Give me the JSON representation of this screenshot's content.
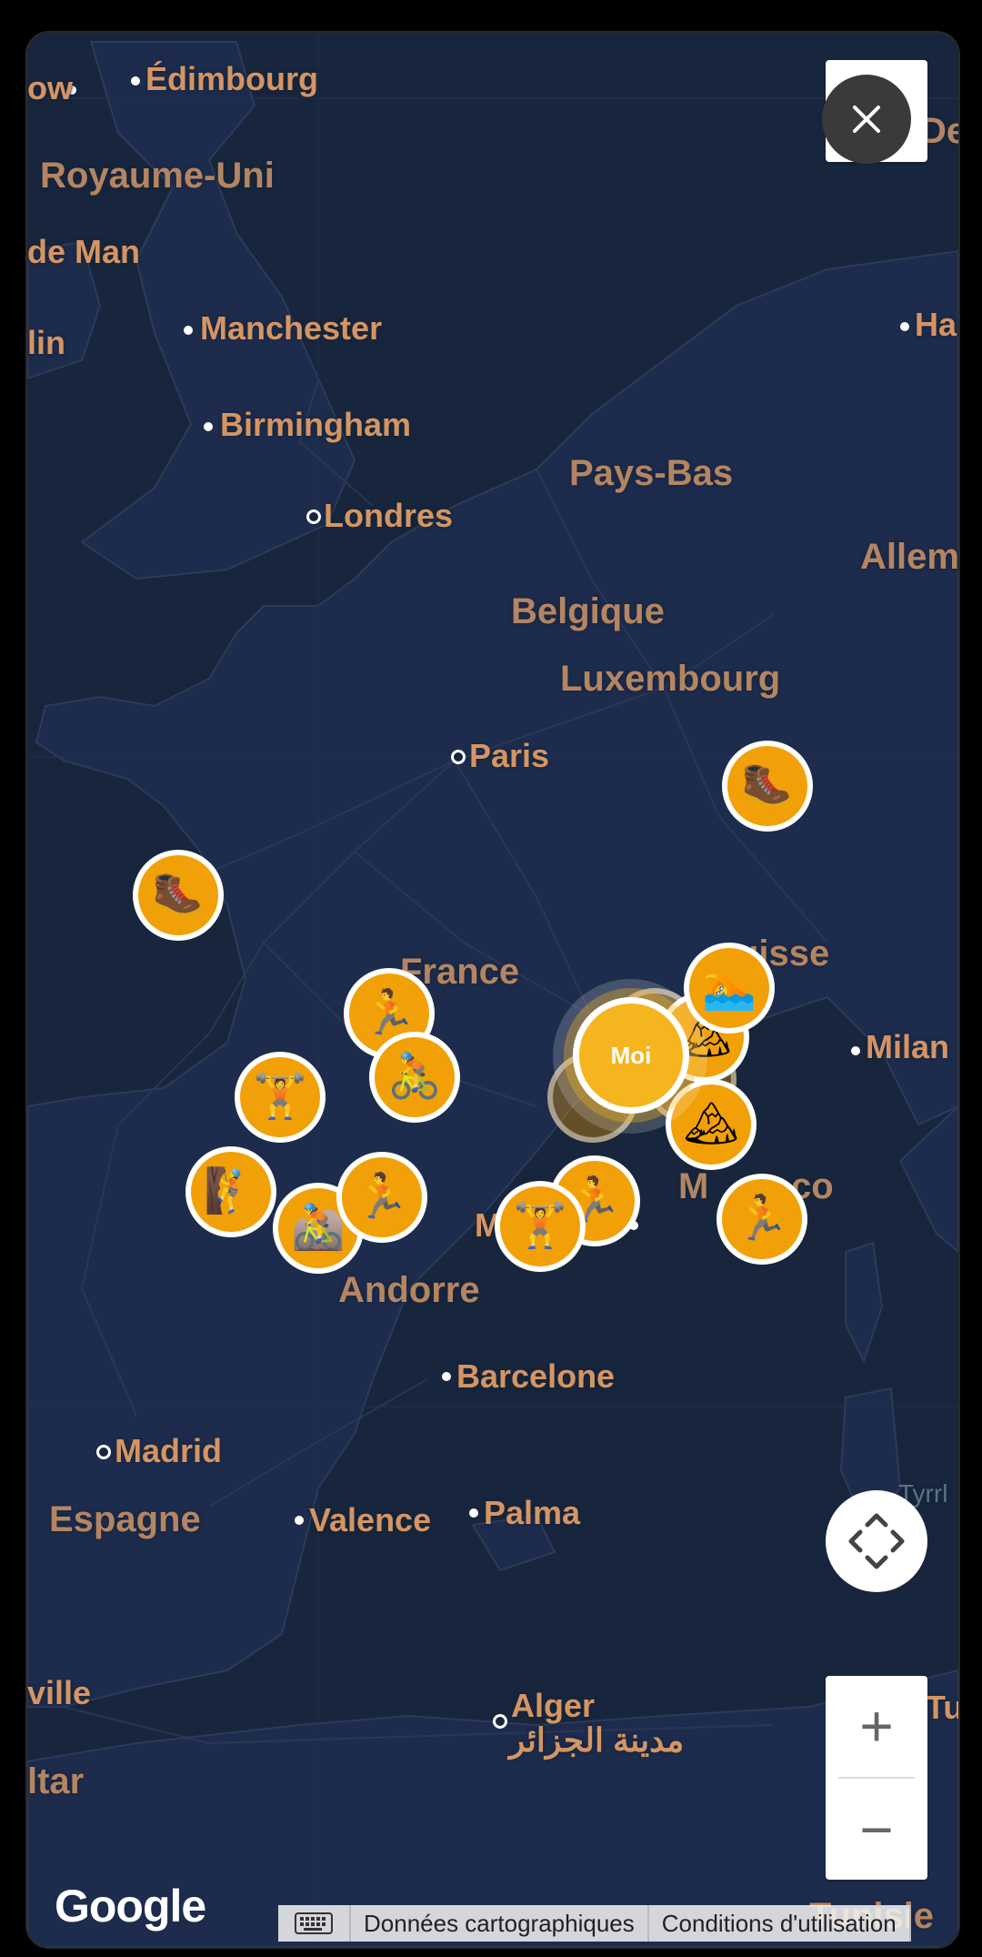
{
  "map": {
    "labels": {
      "edinburgh": "Édimbourg",
      "glasgow_partial": "ow",
      "uk": "Royaume-Uni",
      "isle_of_man": "de Man",
      "dublin_partial": "lin",
      "manchester": "Manchester",
      "birmingham": "Birmingham",
      "london": "Londres",
      "netherlands": "Pays-Bas",
      "germany_partial": "Allema",
      "hamburg_partial": "Ha",
      "belgium": "Belgique",
      "luxembourg": "Luxembourg",
      "paris": "Paris",
      "suisse_partial": "uisse",
      "france": "France",
      "milan": "Milan",
      "monaco_partial": "co",
      "marseille_partial": "M",
      "marseille_partial2": "ille",
      "andorra": "Andorre",
      "barcelona": "Barcelone",
      "madrid": "Madrid",
      "spain": "Espagne",
      "valencia": "Valence",
      "palma": "Palma",
      "tyrrhenian_partial": "Tyrrl",
      "seville_partial": "ville",
      "gibraltar_partial": "ltar",
      "algiers": "Alger",
      "algiers_ar": "مدينة الجزائر",
      "tunis_partial": "Tu",
      "tunisia_partial": "Tunisie",
      "denmark_partial": "Dema"
    },
    "me_label": "Moi",
    "markers": [
      {
        "id": "hiking-1",
        "icon": "hiking-boot-icon",
        "glyph": "🥾"
      },
      {
        "id": "hiking-2",
        "icon": "hiking-boot-icon",
        "glyph": "🥾"
      },
      {
        "id": "running-1",
        "icon": "running-icon",
        "glyph": "🏃"
      },
      {
        "id": "cycling-1",
        "icon": "cycling-icon",
        "glyph": "🚴"
      },
      {
        "id": "weightlifting-1",
        "icon": "weightlifting-icon",
        "glyph": "🏋"
      },
      {
        "id": "climbing-1",
        "icon": "climbing-icon",
        "glyph": "🧗"
      },
      {
        "id": "cycling-2",
        "icon": "cycling-icon",
        "glyph": "🚵"
      },
      {
        "id": "running-2",
        "icon": "running-icon",
        "glyph": "🏃"
      },
      {
        "id": "weightlifting-2",
        "icon": "weightlifting-icon",
        "glyph": "🏋"
      },
      {
        "id": "running-3",
        "icon": "running-icon",
        "glyph": "🏃"
      },
      {
        "id": "swimming-1",
        "icon": "swimming-icon",
        "glyph": "🏊"
      },
      {
        "id": "mountain-1",
        "icon": "mountain-icon",
        "glyph": "🏔"
      },
      {
        "id": "running-4",
        "icon": "running-icon",
        "glyph": "🏃"
      }
    ]
  },
  "controls": {
    "zoom_in": "+",
    "zoom_out": "−",
    "recenter_icon": "recenter-icon",
    "close_icon": "close-icon"
  },
  "footer": {
    "google_logo": "Google",
    "keyboard_icon": "keyboard-icon",
    "map_data": "Données cartographiques",
    "terms": "Conditions d'utilisation"
  }
}
